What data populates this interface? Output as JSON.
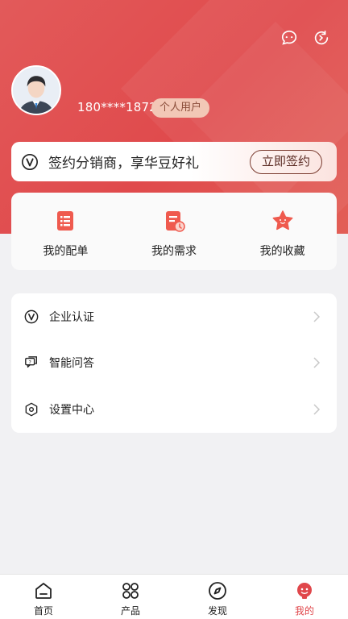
{
  "profile": {
    "phone": "180****1872",
    "badge": "个人用户"
  },
  "sign_banner": {
    "text": "签约分销商，享华豆好礼",
    "button": "立即签约"
  },
  "quick_actions": [
    {
      "label": "我的配单",
      "icon": "order-list-icon"
    },
    {
      "label": "我的需求",
      "icon": "requirement-doc-icon"
    },
    {
      "label": "我的收藏",
      "icon": "star-icon"
    }
  ],
  "menu": [
    {
      "label": "企业认证",
      "icon": "verify-v-icon"
    },
    {
      "label": "智能问答",
      "icon": "qa-chat-icon"
    },
    {
      "label": "设置中心",
      "icon": "hexagon-settings-icon"
    }
  ],
  "tabbar": [
    {
      "label": "首页",
      "icon": "home-icon"
    },
    {
      "label": "产品",
      "icon": "grid-icon"
    },
    {
      "label": "发现",
      "icon": "compass-icon"
    },
    {
      "label": "我的",
      "icon": "profile-icon",
      "active": true
    }
  ],
  "colors": {
    "accent": "#e0474b",
    "hero_bg": "#e25a5a",
    "badge_bg": "#f2c7b6"
  }
}
